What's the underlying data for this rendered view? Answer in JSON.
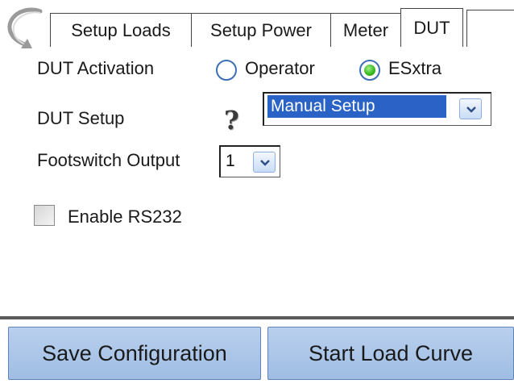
{
  "tabs": [
    {
      "label": "Setup Loads",
      "active": false
    },
    {
      "label": "Setup Power",
      "active": false
    },
    {
      "label": "Meter",
      "active": false
    },
    {
      "label": "DUT",
      "active": true
    }
  ],
  "dut_activation": {
    "label": "DUT Activation",
    "options": [
      {
        "label": "Operator",
        "checked": false
      },
      {
        "label": "ESxtra",
        "checked": true
      }
    ]
  },
  "dut_setup": {
    "label": "DUT Setup",
    "help_icon": "question-mark",
    "selected": "Manual Setup"
  },
  "footswitch": {
    "label": "Footswitch Output",
    "selected": "1"
  },
  "rs232": {
    "label": "Enable RS232",
    "checked": false
  },
  "buttons": {
    "save": "Save Configuration",
    "start": "Start Load Curve"
  },
  "colors": {
    "button_fill": "#aac5e8",
    "selection": "#2a63c5",
    "radio_on": "#3dbb22"
  }
}
